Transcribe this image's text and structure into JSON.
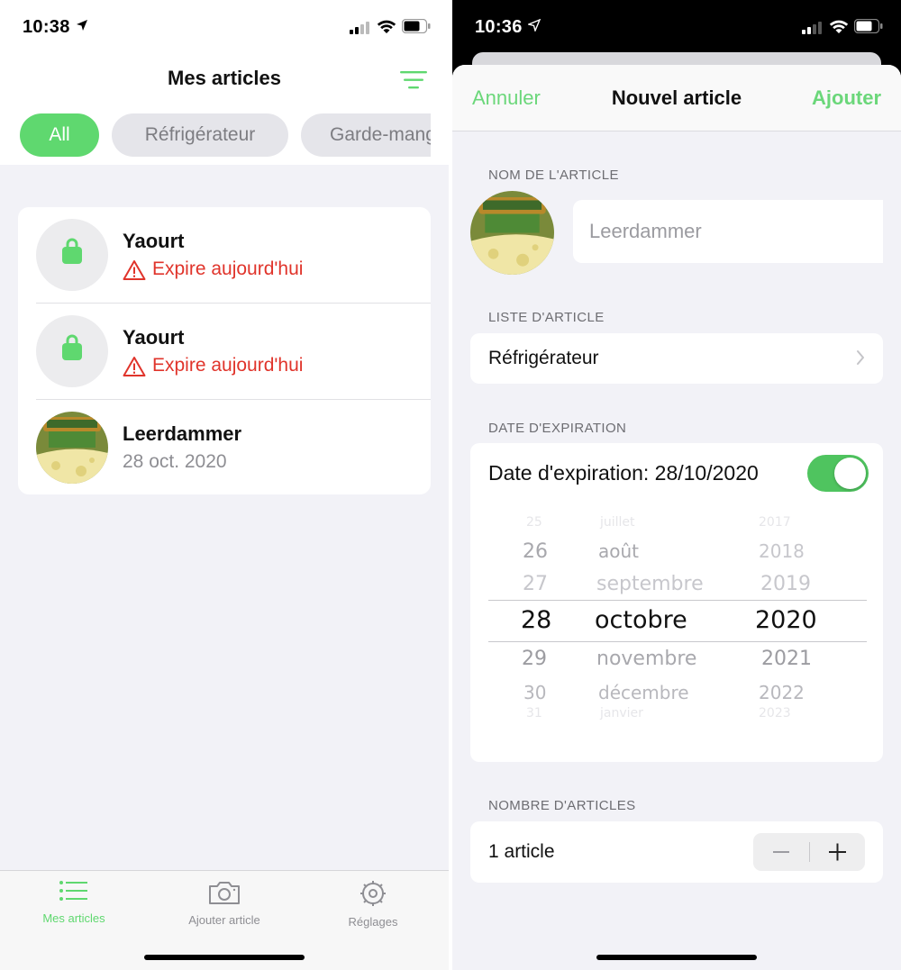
{
  "left": {
    "status": {
      "time": "10:38"
    },
    "title": "Mes articles",
    "chips": [
      "All",
      "Réfrigérateur",
      "Garde-manger"
    ],
    "items": [
      {
        "name": "Yaourt",
        "status": "Expire aujourd'hui",
        "thumb": "bag-icon"
      },
      {
        "name": "Yaourt",
        "status": "Expire aujourd'hui",
        "thumb": "bag-icon"
      },
      {
        "name": "Leerdammer",
        "status": "28 oct. 2020",
        "thumb": "cheese-photo"
      }
    ],
    "tabs": [
      {
        "label": "Mes articles",
        "icon": "list-icon"
      },
      {
        "label": "Ajouter article",
        "icon": "camera-icon"
      },
      {
        "label": "Réglages",
        "icon": "gear-icon"
      }
    ]
  },
  "right": {
    "status": {
      "time": "10:36"
    },
    "nav": {
      "cancel": "Annuler",
      "title": "Nouvel article",
      "add": "Ajouter"
    },
    "name_section": {
      "label": "NOM DE L'ARTICLE",
      "value": "Leerdammer"
    },
    "list_section": {
      "label": "LISTE D'ARTICLE",
      "value": "Réfrigérateur"
    },
    "date_section": {
      "label": "DATE D'EXPIRATION",
      "row_label": "Date d'expiration: 28/10/2020",
      "toggle_on": true,
      "picker": {
        "days": [
          "25",
          "26",
          "27",
          "28",
          "29",
          "30",
          "31"
        ],
        "months": [
          "juillet",
          "août",
          "septembre",
          "octobre",
          "novembre",
          "décembre",
          "janvier"
        ],
        "years": [
          "2017",
          "2018",
          "2019",
          "2020",
          "2021",
          "2022",
          "2023"
        ],
        "selected": {
          "day": "28",
          "month": "octobre",
          "year": "2020"
        }
      }
    },
    "count_section": {
      "label": "NOMBRE D'ARTICLES",
      "value": "1 article",
      "minus": "−",
      "plus": "+"
    }
  },
  "colors": {
    "accent": "#5fd86f",
    "warning": "#e0342b",
    "toggle": "#4fc45f"
  }
}
